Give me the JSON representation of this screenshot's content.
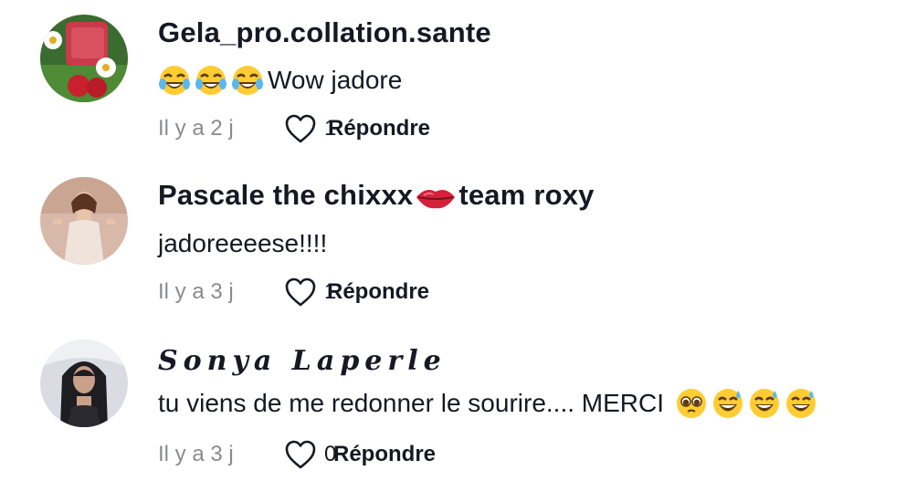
{
  "comments": [
    {
      "username": "Gela_pro.collation.sante",
      "text": "Wow jadore",
      "emoji_prefix": [
        "face-with-tears-of-joy-icon",
        "face-with-tears-of-joy-icon",
        "face-with-tears-of-joy-icon"
      ],
      "time": "Il y a 2 j",
      "likes": "1",
      "reply_label": "Répondre"
    },
    {
      "username_part1": "Pascale the chixxx",
      "username_emoji": "lips-icon",
      "username_part2": "team roxy",
      "text": "jadoreeeese!!!!",
      "time": "Il y a 3 j",
      "likes": "1",
      "reply_label": "Répondre"
    },
    {
      "username": "𝑺𝒐𝒏𝒚𝒂 𝑳𝒂𝒑𝒆𝒓𝒍𝒆",
      "text": "tu viens de me redonner le sourire.... MERCI",
      "emoji_suffix": [
        "pleading-face-icon",
        "grinning-sweat-icon",
        "grinning-sweat-icon",
        "grinning-sweat-icon"
      ],
      "time": "Il y a 3 j",
      "likes": "0",
      "reply_label": "Répondre"
    }
  ],
  "colors": {
    "text": "#161823",
    "muted": "#8a8b91",
    "heart_outline": "#161823"
  }
}
